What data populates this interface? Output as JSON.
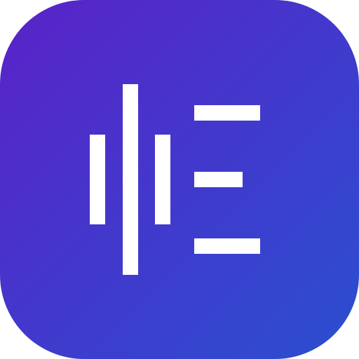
{
  "app_icon": {
    "icon_name": "audio-waveform-text-icon",
    "colors": {
      "gradient_start": "#5A22C8",
      "gradient_end": "#2A4FD0",
      "glyph": "#FFFFFF"
    }
  }
}
